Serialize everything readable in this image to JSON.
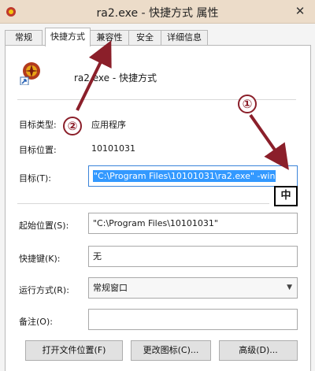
{
  "window": {
    "title": "ra2.exe - 快捷方式 属性",
    "close_glyph": "✕"
  },
  "tabs": [
    {
      "label": "常规"
    },
    {
      "label": "快捷方式"
    },
    {
      "label": "兼容性"
    },
    {
      "label": "安全"
    },
    {
      "label": "详细信息"
    }
  ],
  "header": {
    "name": "ra2.exe - 快捷方式"
  },
  "fields": {
    "target_type_label": "目标类型:",
    "target_type_value": "应用程序",
    "target_location_label": "目标位置:",
    "target_location_value": "10101031",
    "target_label": "目标(T):",
    "target_value": "\"C:\\Program Files\\10101031\\ra2.exe\" -win",
    "start_in_label": "起始位置(S):",
    "start_in_value": "\"C:\\Program Files\\10101031\"",
    "shortcut_key_label": "快捷键(K):",
    "shortcut_key_value": "无",
    "run_label": "运行方式(R):",
    "run_value": "常规窗口",
    "comment_label": "备注(O):",
    "comment_value": ""
  },
  "buttons": {
    "open_location": "打开文件位置(F)",
    "change_icon": "更改图标(C)...",
    "advanced": "高级(D)..."
  },
  "ime_indicator": "中",
  "annotations": {
    "num1": "①",
    "num2": "②",
    "color": "#8b1f2a"
  }
}
